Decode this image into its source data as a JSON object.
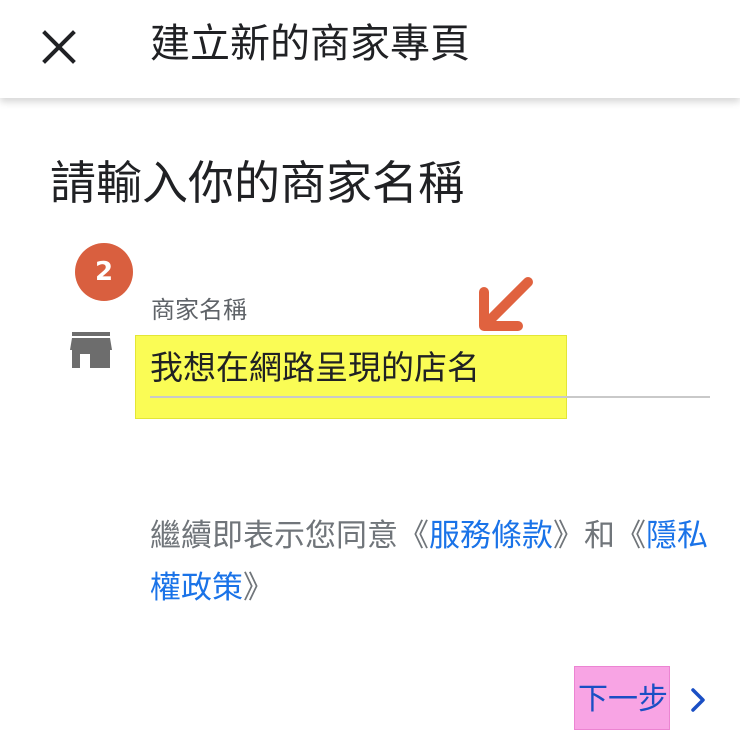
{
  "app_bar": {
    "title": "建立新的商家專頁",
    "close_icon": "close-icon"
  },
  "heading": "請輸入你的商家名稱",
  "step": {
    "number": "2",
    "color": "#d95f3f"
  },
  "business_name": {
    "icon": "store-icon",
    "label": "商家名稱",
    "value": "我想在網路呈現的店名",
    "highlight_color": "#fafc55"
  },
  "annotation": {
    "arrow_icon": "arrow-down-left-icon",
    "color": "#e0623f"
  },
  "terms": {
    "prefix": "繼續即表示您同意《",
    "terms_link": "服務條款",
    "middle": "》和《",
    "privacy_link": "隱私權政策",
    "suffix": "》",
    "link_color": "#1a73e8"
  },
  "next_button": {
    "label": "下一步",
    "icon": "chevron-right-icon",
    "highlight_color": "#f8a4e4"
  }
}
